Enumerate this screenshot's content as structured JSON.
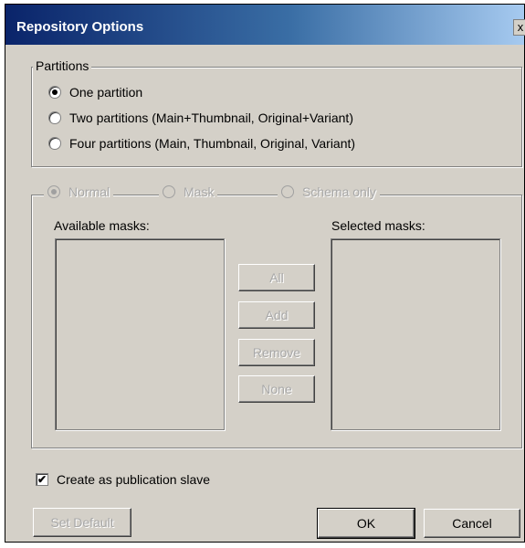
{
  "window": {
    "title": "Repository Options",
    "close_glyph": "x"
  },
  "partitions": {
    "group_label": "Partitions",
    "options": [
      {
        "label": "One partition",
        "checked": true
      },
      {
        "label": "Two partitions (Main+Thumbnail, Original+Variant)",
        "checked": false
      },
      {
        "label": "Four partitions (Main, Thumbnail, Original, Variant)",
        "checked": false
      }
    ]
  },
  "mode": {
    "options": [
      {
        "label": "Normal",
        "checked": true,
        "enabled": false
      },
      {
        "label": "Mask",
        "checked": false,
        "enabled": false
      },
      {
        "label": "Schema only",
        "checked": false,
        "enabled": false
      }
    ],
    "available_label": "Available masks:",
    "selected_label": "Selected masks:",
    "buttons": {
      "all": "All",
      "add": "Add",
      "remove": "Remove",
      "none": "None"
    }
  },
  "publication_slave": {
    "label": "Create as publication slave",
    "checked": true,
    "check_glyph": "✔"
  },
  "footer": {
    "set_default": "Set Default",
    "ok": "OK",
    "cancel": "Cancel"
  }
}
